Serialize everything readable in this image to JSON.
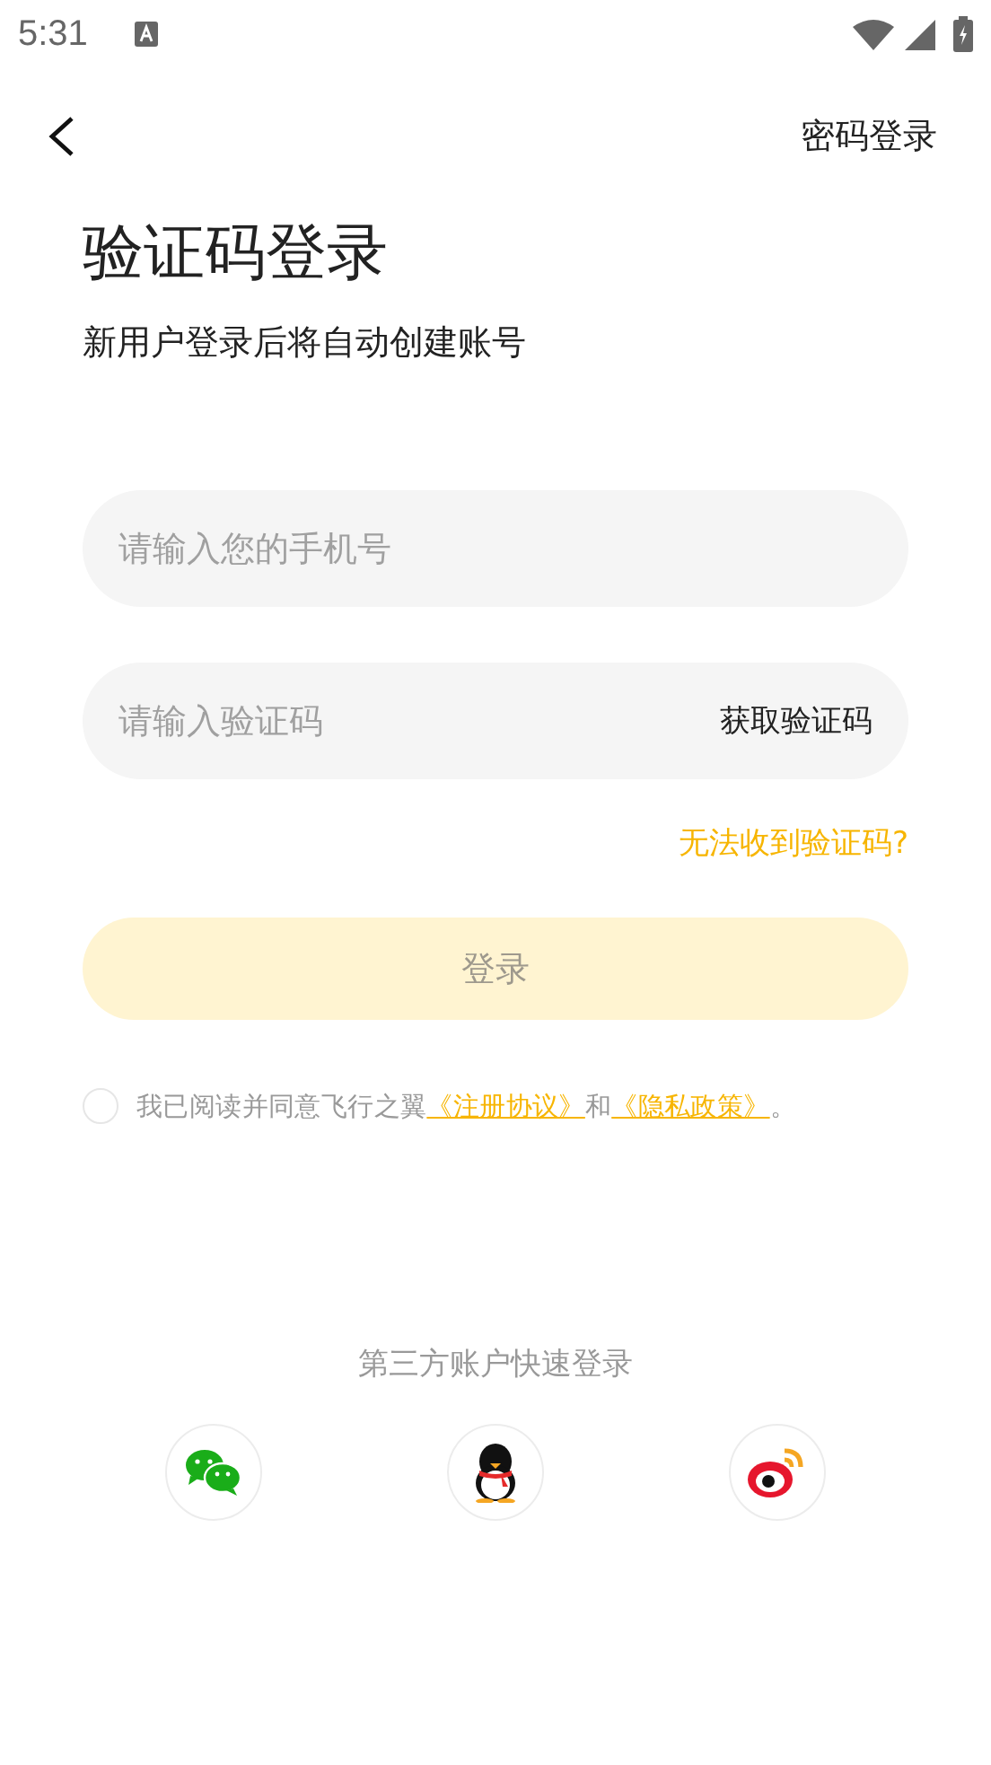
{
  "status_bar": {
    "time": "5:31"
  },
  "nav": {
    "action": "密码登录"
  },
  "title": "验证码登录",
  "subtitle": "新用户登录后将自动创建账号",
  "phone_field": {
    "placeholder": "请输入您的手机号"
  },
  "code_field": {
    "placeholder": "请输入验证码",
    "action": "获取验证码"
  },
  "help_link": "无法收到验证码?",
  "login_button": {
    "label": "登录",
    "disabled": true
  },
  "agreement": {
    "checked": false,
    "text": "我已阅读并同意飞行之翼",
    "link_1": "《注册协议》",
    "joiner": "和",
    "link_2": "《隐私政策》",
    "end": "。"
  },
  "third_party": {
    "title": "第三方账户快速登录",
    "options": [
      {
        "kind": "wechat"
      },
      {
        "kind": "qq"
      },
      {
        "kind": "weibo"
      }
    ]
  }
}
